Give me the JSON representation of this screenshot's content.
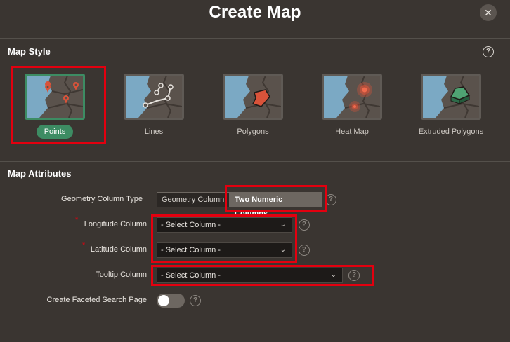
{
  "dialog": {
    "title": "Create Map",
    "close_label": "✕"
  },
  "map_style": {
    "section_title": "Map Style",
    "help_label": "?",
    "options": [
      {
        "label": "Points",
        "selected": true
      },
      {
        "label": "Lines",
        "selected": false
      },
      {
        "label": "Polygons",
        "selected": false
      },
      {
        "label": "Heat Map",
        "selected": false
      },
      {
        "label": "Extruded Polygons",
        "selected": false
      }
    ]
  },
  "map_attributes": {
    "section_title": "Map Attributes",
    "geometry_column_type": {
      "label": "Geometry Column Type",
      "options": [
        "Geometry Column",
        "Two Numeric Columns"
      ],
      "selected": "Two Numeric Columns",
      "help_label": "?"
    },
    "longitude_column": {
      "label": "Longitude Column",
      "required_mark": "*",
      "value": "- Select Column -",
      "help_label": "?"
    },
    "latitude_column": {
      "label": "Latitude Column",
      "required_mark": "*",
      "value": "- Select Column -",
      "help_label": "?"
    },
    "tooltip_column": {
      "label": "Tooltip Column",
      "value": "- Select Column -",
      "help_label": "?"
    },
    "faceted_search": {
      "label": "Create Faceted Search Page",
      "enabled": false,
      "help_label": "?"
    }
  },
  "colors": {
    "background": "#3a3531",
    "accent_green": "#3d8c63",
    "highlight_red": "#e3000f",
    "map_water": "#7ba9c4",
    "map_land": "#5a524c"
  }
}
